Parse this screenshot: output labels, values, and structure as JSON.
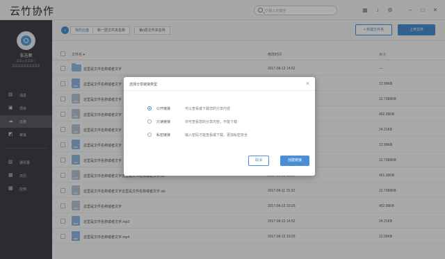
{
  "app": {
    "title": "云竹协作"
  },
  "titlebar": {
    "search_placeholder": "Q 输入关键字",
    "icons": [
      "building-icon",
      "bell-icon",
      "settings-icon",
      "minimize-icon",
      "maximize-icon",
      "close-icon"
    ]
  },
  "sidebar": {
    "user_name": "张吉顺",
    "user_sub1": "某某公司某部门",
    "user_sub2": "某某某某某某某某某某",
    "items": [
      {
        "label": "消息",
        "icon": "message-icon"
      },
      {
        "label": "项目",
        "icon": "project-icon"
      },
      {
        "label": "云盘",
        "icon": "cloud-icon"
      },
      {
        "label": "审批",
        "icon": "approval-icon"
      },
      {
        "label": "通讯录",
        "icon": "contacts-icon"
      },
      {
        "label": "日历",
        "icon": "calendar-icon"
      },
      {
        "label": "应用",
        "icon": "apps-icon"
      }
    ],
    "active_index": 2
  },
  "breadcrumb": [
    "我的云盘",
    "新一层文件夹名称",
    "第n层文件夹名称"
  ],
  "actions": {
    "new_folder": "+ 新建文件夹",
    "upload": "上传文件"
  },
  "table": {
    "headers": {
      "name": "文件名 ▾",
      "time": "修改时间",
      "size": "大小"
    },
    "rows": [
      {
        "type": "folder",
        "badge": "",
        "name": "这里是文件名称或者文字",
        "time": "2017-06-12 14:52",
        "size": "—"
      },
      {
        "type": "img",
        "badge": "JPG",
        "name": "这里是文件名称或者文字",
        "time": "",
        "size": "12.06KB"
      },
      {
        "type": "doc",
        "badge": "DOC",
        "name": "这里是文件名称或者文字",
        "time": "",
        "size": "12.7368KB"
      },
      {
        "type": "pdf",
        "badge": "PDF",
        "name": "这里是文件名称或者文字",
        "time": "",
        "size": "452.06KB"
      },
      {
        "type": "zip",
        "badge": "ZIP",
        "name": "这里是文件名称或者文字",
        "time": "",
        "size": "24.21KB"
      },
      {
        "type": "img",
        "badge": "PNG",
        "name": "这里是文件名称或者文字",
        "time": "",
        "size": "12.06KB"
      },
      {
        "type": "img",
        "badge": "GIF",
        "name": "这里是文件名称或者文字",
        "time": "",
        "size": "12.7368KB"
      },
      {
        "type": "doc",
        "badge": "TXT",
        "name": "这里是文件名称或者文字这里是文件名称或者文字.txt",
        "time": "2017-06-12 10:25",
        "size": "451.06KB"
      },
      {
        "type": "doc",
        "badge": "XLS",
        "name": "这里是文件名称或者文字这里是文件名称或者文字.xls",
        "time": "2017-06-11 15:32",
        "size": "12.7368KB"
      },
      {
        "type": "doc",
        "badge": "PPT",
        "name": "这里是文件名称或者文字",
        "time": "2017-06-12 10:25",
        "size": "452.06KB"
      },
      {
        "type": "mp",
        "badge": "MP3",
        "name": "这里是文件名称或者文字.mp3",
        "time": "2017-06-12 14:52",
        "size": "24.21KB"
      },
      {
        "type": "mp",
        "badge": "MP4",
        "name": "这里是文件名称或者文字.mp4",
        "time": "2017-06-12 10:25",
        "size": "12.06KB"
      }
    ]
  },
  "dialog": {
    "title": "选择分享链接类型",
    "options": [
      {
        "label": "公开链接",
        "desc": "可以查看或下载您的分享内容",
        "selected": true
      },
      {
        "label": "只读链接",
        "desc": "仅可查看您的分享内容，不能下载",
        "selected": false
      },
      {
        "label": "私密链接",
        "desc": "输入密码才能查看或下载，更加私密安全",
        "selected": false
      }
    ],
    "cancel": "取消",
    "confirm": "创建链接"
  },
  "colors": {
    "accent": "#4a8ed6",
    "sidebar": "#3f4146",
    "sidebar_active": "#5a5d63"
  }
}
